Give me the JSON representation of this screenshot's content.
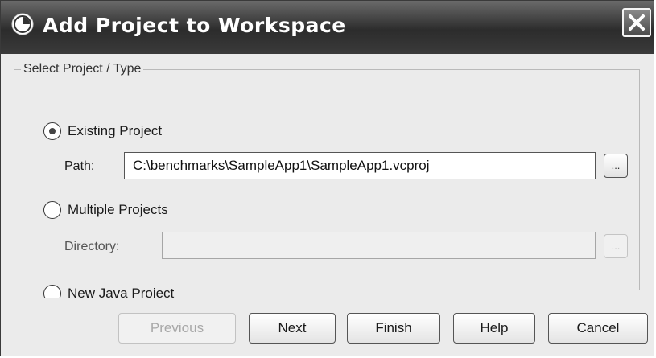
{
  "window": {
    "title": "Add Project to Workspace",
    "app_icon": "app-clock-icon",
    "close_icon": "close-icon"
  },
  "group": {
    "legend": "Select Project / Type",
    "options": [
      {
        "label": "Existing Project",
        "selected": true
      },
      {
        "label": "Multiple Projects",
        "selected": false
      },
      {
        "label": "New Java Project",
        "selected": false
      }
    ],
    "path": {
      "label": "Path:",
      "value": "C:\\benchmarks\\SampleApp1\\SampleApp1.vcproj",
      "browse_label": "..."
    },
    "directory": {
      "label": "Directory:",
      "value": "",
      "browse_label": "...",
      "enabled": false
    }
  },
  "buttons": {
    "previous": "Previous",
    "next": "Next",
    "finish": "Finish",
    "help": "Help",
    "cancel": "Cancel"
  }
}
